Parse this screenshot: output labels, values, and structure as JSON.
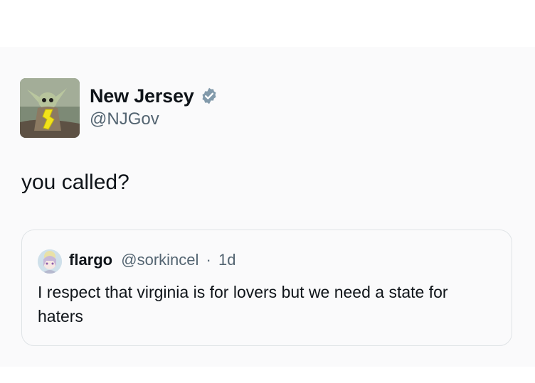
{
  "tweet": {
    "author": {
      "name": "New Jersey",
      "handle": "@NJGov",
      "verified": true,
      "avatar_icon": "baby-yoda-holding-nj-map-avatar",
      "verified_color": "#829aab"
    },
    "text": "you called?",
    "quoted_tweet": {
      "author": {
        "name": "flargo",
        "handle": "@sorkincel",
        "avatar_icon": "anime-character-avatar"
      },
      "separator": "·",
      "time": "1d",
      "text": "I respect that virginia is for lovers but we need a state for haters"
    }
  }
}
